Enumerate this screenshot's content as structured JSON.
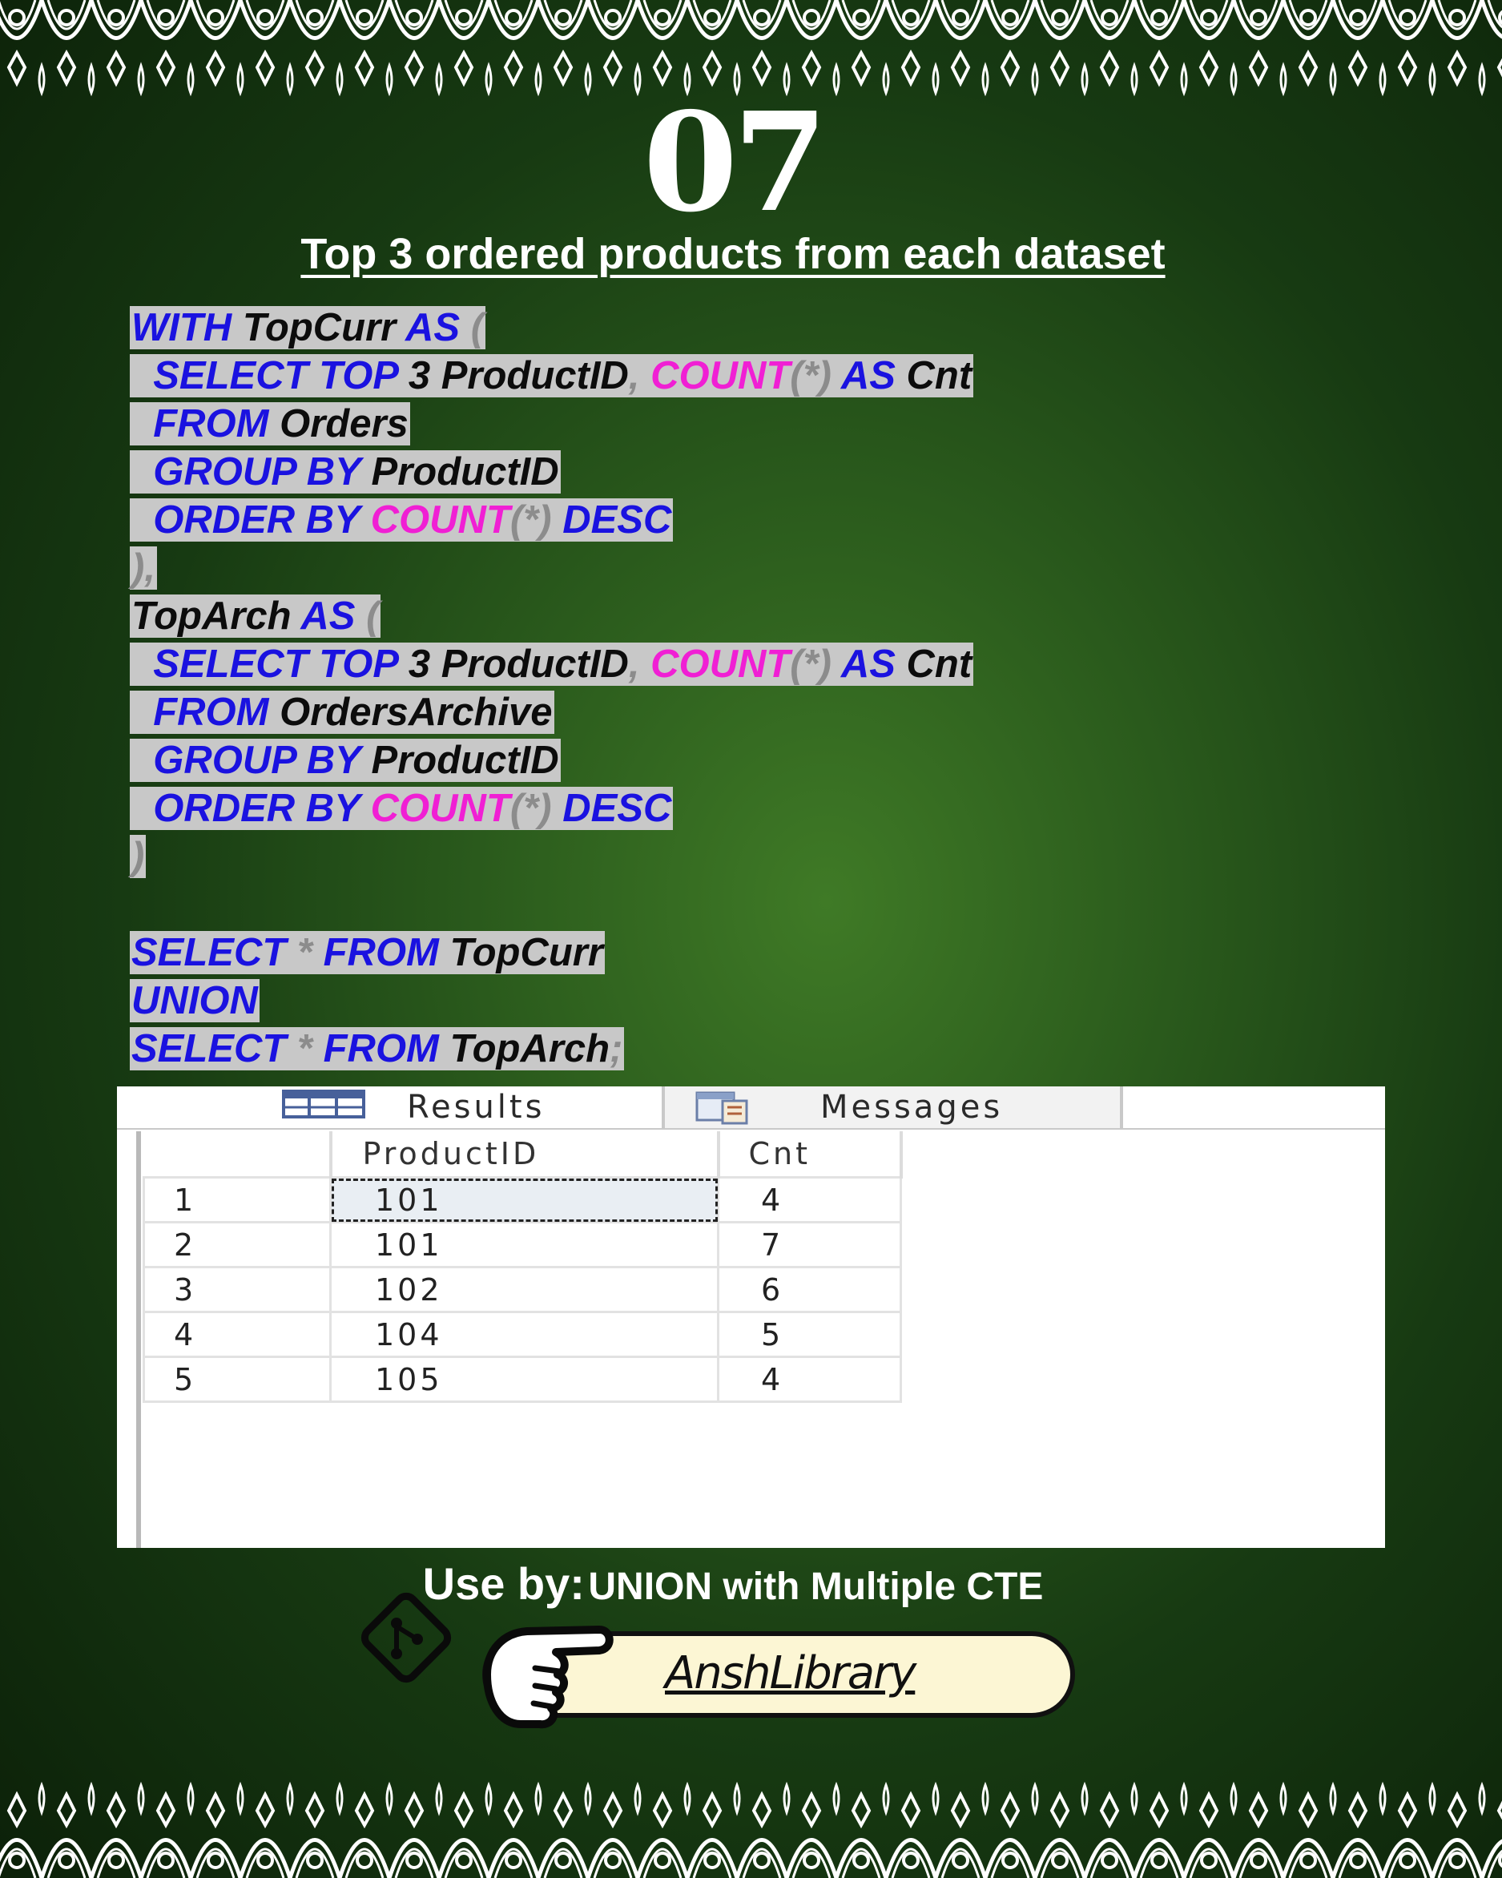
{
  "slide": {
    "number": "07",
    "title": "Top 3 ordered products from each dataset"
  },
  "code_lines": [
    [
      [
        "kw",
        "WITH"
      ],
      [
        "sp",
        " "
      ],
      [
        "id",
        "TopCurr"
      ],
      [
        "sp",
        " "
      ],
      [
        "kw",
        "AS"
      ],
      [
        "sp",
        " "
      ],
      [
        "pn",
        "("
      ]
    ],
    [
      [
        "sp",
        "  "
      ],
      [
        "kw",
        "SELECT"
      ],
      [
        "sp",
        " "
      ],
      [
        "kw",
        "TOP"
      ],
      [
        "sp",
        " "
      ],
      [
        "num",
        "3"
      ],
      [
        "sp",
        " "
      ],
      [
        "id",
        "ProductID"
      ],
      [
        "pn",
        ","
      ],
      [
        "sp",
        " "
      ],
      [
        "fn",
        "COUNT"
      ],
      [
        "pn",
        "(*)"
      ],
      [
        "sp",
        " "
      ],
      [
        "kw",
        "AS"
      ],
      [
        "sp",
        " "
      ],
      [
        "id",
        "Cnt"
      ]
    ],
    [
      [
        "sp",
        "  "
      ],
      [
        "kw",
        "FROM"
      ],
      [
        "sp",
        " "
      ],
      [
        "id",
        "Orders"
      ]
    ],
    [
      [
        "sp",
        "  "
      ],
      [
        "kw",
        "GROUP BY"
      ],
      [
        "sp",
        " "
      ],
      [
        "id",
        "ProductID"
      ]
    ],
    [
      [
        "sp",
        "  "
      ],
      [
        "kw",
        "ORDER BY"
      ],
      [
        "sp",
        " "
      ],
      [
        "fn",
        "COUNT"
      ],
      [
        "pn",
        "(*)"
      ],
      [
        "sp",
        " "
      ],
      [
        "kw",
        "DESC"
      ]
    ],
    [
      [
        "pn",
        "),"
      ]
    ],
    [
      [
        "id",
        "TopArch"
      ],
      [
        "sp",
        " "
      ],
      [
        "kw",
        "AS"
      ],
      [
        "sp",
        " "
      ],
      [
        "pn",
        "("
      ]
    ],
    [
      [
        "sp",
        "  "
      ],
      [
        "kw",
        "SELECT"
      ],
      [
        "sp",
        " "
      ],
      [
        "kw",
        "TOP"
      ],
      [
        "sp",
        " "
      ],
      [
        "num",
        "3"
      ],
      [
        "sp",
        " "
      ],
      [
        "id",
        "ProductID"
      ],
      [
        "pn",
        ","
      ],
      [
        "sp",
        " "
      ],
      [
        "fn",
        "COUNT"
      ],
      [
        "pn",
        "(*)"
      ],
      [
        "sp",
        " "
      ],
      [
        "kw",
        "AS"
      ],
      [
        "sp",
        " "
      ],
      [
        "id",
        "Cnt"
      ]
    ],
    [
      [
        "sp",
        "  "
      ],
      [
        "kw",
        "FROM"
      ],
      [
        "sp",
        " "
      ],
      [
        "id",
        "OrdersArchive"
      ]
    ],
    [
      [
        "sp",
        "  "
      ],
      [
        "kw",
        "GROUP BY"
      ],
      [
        "sp",
        " "
      ],
      [
        "id",
        "ProductID"
      ]
    ],
    [
      [
        "sp",
        "  "
      ],
      [
        "kw",
        "ORDER BY"
      ],
      [
        "sp",
        " "
      ],
      [
        "fn",
        "COUNT"
      ],
      [
        "pn",
        "(*)"
      ],
      [
        "sp",
        " "
      ],
      [
        "kw",
        "DESC"
      ]
    ],
    [
      [
        "pn",
        ")"
      ]
    ],
    [],
    [
      [
        "kw",
        "SELECT"
      ],
      [
        "sp",
        " "
      ],
      [
        "pn",
        "*"
      ],
      [
        "sp",
        " "
      ],
      [
        "kw",
        "FROM"
      ],
      [
        "sp",
        " "
      ],
      [
        "id",
        "TopCurr"
      ]
    ],
    [
      [
        "kw",
        "UNION"
      ]
    ],
    [
      [
        "kw",
        "SELECT"
      ],
      [
        "sp",
        " "
      ],
      [
        "pn",
        "*"
      ],
      [
        "sp",
        " "
      ],
      [
        "kw",
        "FROM"
      ],
      [
        "sp",
        " "
      ],
      [
        "id",
        "TopArch"
      ],
      [
        "pn",
        ";"
      ]
    ]
  ],
  "results_panel": {
    "tabs": {
      "results": "Results",
      "messages": "Messages"
    },
    "columns": [
      "",
      "ProductID",
      "Cnt"
    ],
    "rows": [
      [
        "1",
        "101",
        "4"
      ],
      [
        "2",
        "101",
        "7"
      ],
      [
        "3",
        "102",
        "6"
      ],
      [
        "4",
        "104",
        "5"
      ],
      [
        "5",
        "105",
        "4"
      ]
    ],
    "selected_cell": {
      "row": 0,
      "col": 1
    }
  },
  "footer": {
    "use_by_label": "Use by:",
    "use_by_value": "UNION with Multiple CTE",
    "brand": "AnshLibrary"
  },
  "colors": {
    "keyword": "#1a12e0",
    "function": "#f01fd4",
    "identifier": "#0c0c0c",
    "punctuation": "#8c8c8c",
    "highlight": "#c8c8c8",
    "brand_pill": "#fcf6d4"
  }
}
